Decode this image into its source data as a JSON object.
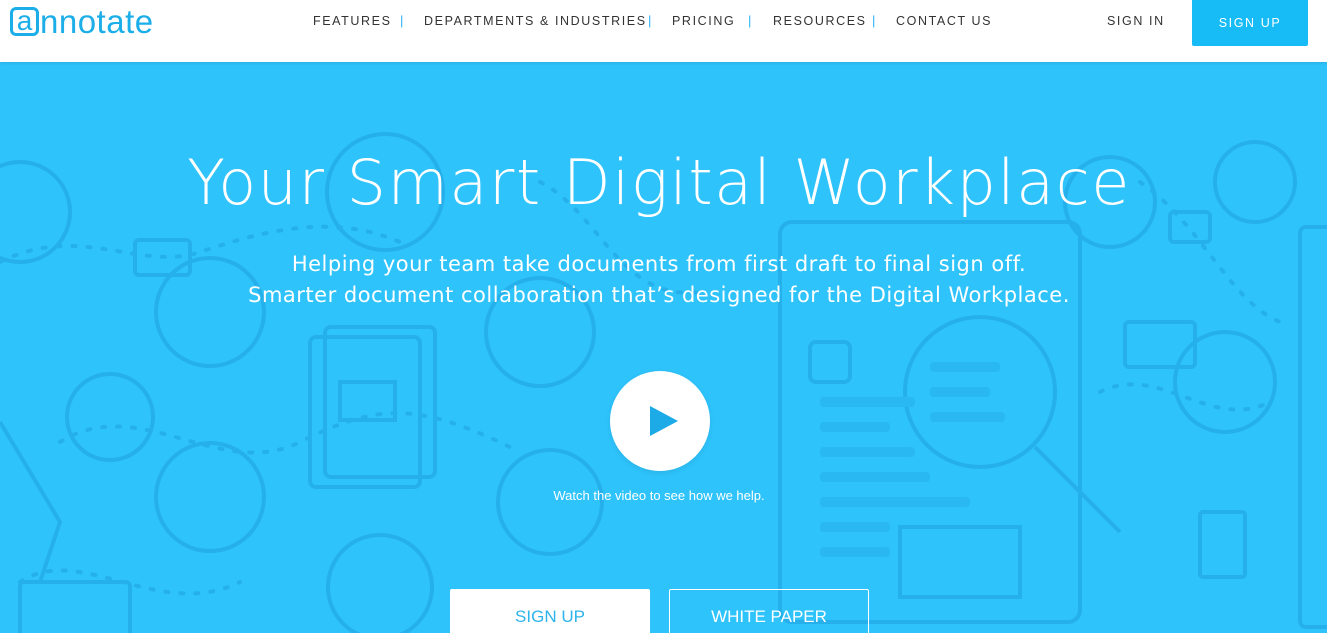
{
  "brand": {
    "logo_first": "a",
    "logo_rest": "nnotate",
    "color": "#1baee8"
  },
  "nav": {
    "items": [
      "FEATURES",
      "DEPARTMENTS & INDUSTRIES",
      "PRICING",
      "RESOURCES",
      "CONTACT US"
    ],
    "separator": "|",
    "sign_in": "SIGN IN",
    "sign_up": "SIGN UP"
  },
  "hero": {
    "title": "Your Smart Digital Workplace",
    "subtitle_line1": "Helping your team take documents from first draft to final sign off.",
    "subtitle_line2": "Smarter document collaboration that’s designed for the Digital Workplace.",
    "play_icon": "play-icon",
    "watch_text": "Watch the video to see how we help.",
    "primary_button": "SIGN UP",
    "secondary_button": "WHITE PAPER",
    "background_color": "#2ec3fb",
    "accent_color": "#17bbf6"
  }
}
